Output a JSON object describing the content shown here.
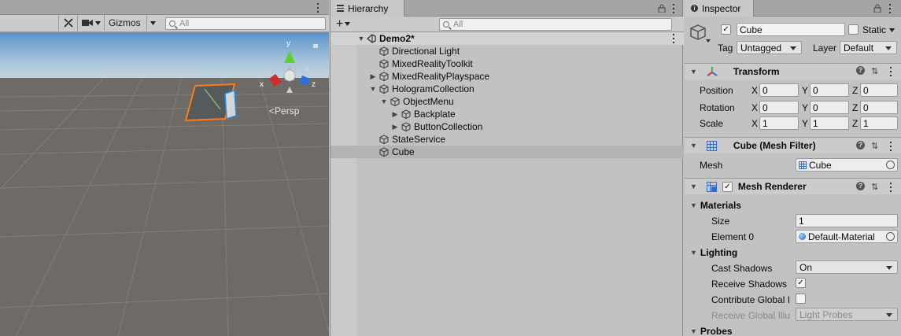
{
  "scene": {
    "gizmos_label": "Gizmos",
    "search_placeholder": "All",
    "persp_label": "Persp",
    "axes": {
      "x": "x",
      "y": "y",
      "z": "z"
    }
  },
  "hierarchy": {
    "tab_label": "Hierarchy",
    "search_placeholder": "All",
    "scene_name": "Demo2*",
    "items": [
      {
        "label": "Directional Light"
      },
      {
        "label": "MixedRealityToolkit"
      },
      {
        "label": "MixedRealityPlayspace"
      },
      {
        "label": "HologramCollection"
      },
      {
        "label": "ObjectMenu"
      },
      {
        "label": "Backplate"
      },
      {
        "label": "ButtonCollection"
      },
      {
        "label": "StateService"
      },
      {
        "label": "Cube"
      }
    ]
  },
  "inspector": {
    "tab_label": "Inspector",
    "object_name": "Cube",
    "static_label": "Static",
    "tag_label": "Tag",
    "tag_value": "Untagged",
    "layer_label": "Layer",
    "layer_value": "Default",
    "transform": {
      "title": "Transform",
      "position_label": "Position",
      "rotation_label": "Rotation",
      "scale_label": "Scale",
      "axis_x": "X",
      "axis_y": "Y",
      "axis_z": "Z",
      "position": [
        "0",
        "0",
        "0"
      ],
      "rotation": [
        "0",
        "0",
        "0"
      ],
      "scale": [
        "1",
        "1",
        "1"
      ]
    },
    "mesh_filter": {
      "title": "Cube (Mesh Filter)",
      "mesh_label": "Mesh",
      "mesh_value": "Cube"
    },
    "mesh_renderer": {
      "title": "Mesh Renderer",
      "materials_label": "Materials",
      "size_label": "Size",
      "size_value": "1",
      "element0_label": "Element 0",
      "element0_value": "Default-Material",
      "lighting_label": "Lighting",
      "cast_shadows_label": "Cast Shadows",
      "cast_shadows_value": "On",
      "receive_shadows_label": "Receive Shadows",
      "contribute_gi_label": "Contribute Global I",
      "receive_gi_label": "Receive Global Illu",
      "receive_gi_value": "Light Probes",
      "probes_label": "Probes"
    }
  }
}
